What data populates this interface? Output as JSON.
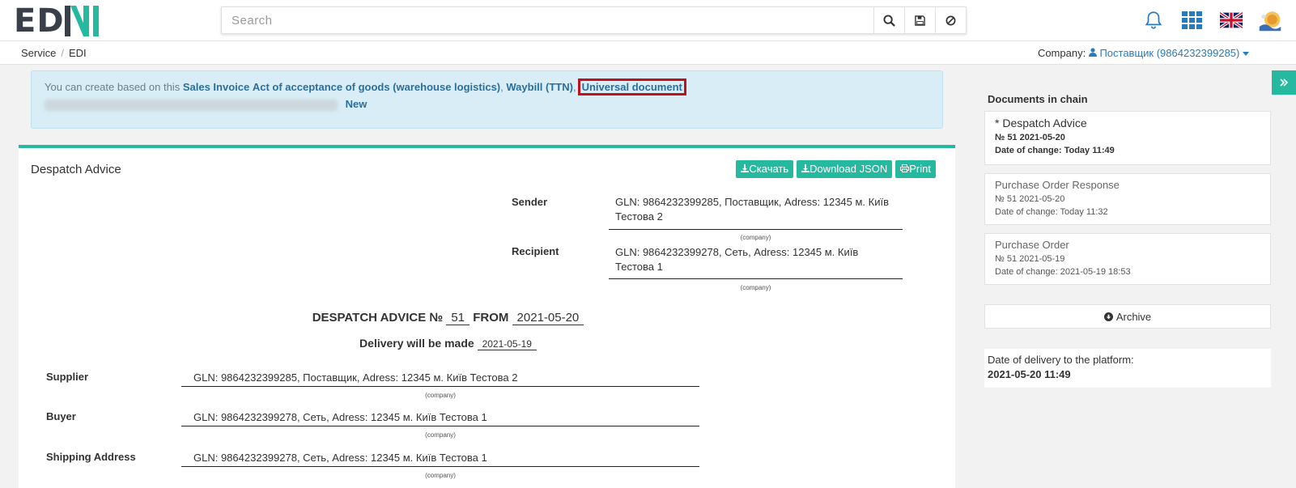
{
  "logo": {
    "part1": "ED",
    "part2": "N",
    "part3": "I"
  },
  "search": {
    "placeholder": "Search"
  },
  "breadcrumb": {
    "items": [
      "Service",
      "EDI"
    ]
  },
  "company": {
    "label": "Company:",
    "value": "Поставщик (9864232399285)"
  },
  "alert": {
    "intro": "You can create based on this",
    "links": [
      "Sales Invoice",
      "Act of acceptance of goods (warehouse logistics)",
      "Waybill (TTN)",
      "Universal document"
    ],
    "new_label": "New"
  },
  "panel": {
    "title": "Despatch Advice",
    "buttons": {
      "download": "Скачать",
      "download_json": "Download JSON",
      "print": "Print"
    },
    "sender": {
      "label": "Sender",
      "value_line1": "GLN: 9864232399285, Поставщик, Adress: 12345 м. Київ",
      "value_line2": "Тестова 2",
      "hint": "(company)"
    },
    "recipient": {
      "label": "Recipient",
      "value_line1": "GLN: 9864232399278, Сеть, Adress: 12345 м. Київ",
      "value_line2": "Тестова 1",
      "hint": "(company)"
    },
    "doc": {
      "title_prefix": "DESPATCH ADVICE №",
      "number": "51",
      "from_label": "FROM",
      "date": "2021-05-20"
    },
    "delivery": {
      "label": "Delivery will be made",
      "date": "2021-05-19"
    },
    "supplier": {
      "label": "Supplier",
      "value": "GLN: 9864232399285, Поставщик, Adress: 12345 м. Київ Тестова 2",
      "hint": "(company)"
    },
    "buyer": {
      "label": "Buyer",
      "value": "GLN: 9864232399278, Сеть, Adress: 12345 м. Київ Тестова 1",
      "hint": "(company)"
    },
    "shipping": {
      "label": "Shipping Address",
      "value": "GLN: 9864232399278, Сеть, Adress: 12345 м. Київ Тестова 1",
      "hint": "(company)"
    }
  },
  "sidebar": {
    "title": "Documents in chain",
    "chain": [
      {
        "title": "* Despatch Advice",
        "number": "№ 51 2021-05-20",
        "changed": "Date of change: Today 11:49"
      },
      {
        "title": "Purchase Order Response",
        "number": "№ 51 2021-05-20",
        "changed": "Date of change: Today 11:32"
      },
      {
        "title": "Purchase Order",
        "number": "№ 51 2021-05-19",
        "changed": "Date of change: 2021-05-19 18:53"
      }
    ],
    "archive_label": "Archive",
    "delivery_label": "Date of delivery to the platform:",
    "delivery_value": "2021-05-20 11:49"
  },
  "colors": {
    "accent": "#25b9a0",
    "link": "#2a7bbd",
    "highlight": "#c0111e",
    "alert_bg": "#d9edf6"
  }
}
